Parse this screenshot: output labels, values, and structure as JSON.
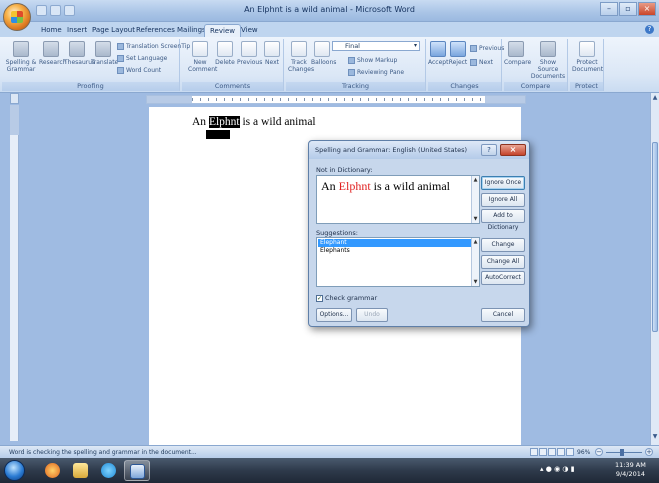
{
  "window": {
    "title": "An Elphnt is a wild animal - Microsoft Word"
  },
  "tabs": [
    "Home",
    "Insert",
    "Page Layout",
    "References",
    "Mailings",
    "Review",
    "View"
  ],
  "active_tab": "Review",
  "ribbon": {
    "proofing": {
      "label": "Proofing",
      "spelling": "Spelling & Grammar",
      "research": "Research",
      "thesaurus": "Thesaurus",
      "translate": "Translate",
      "translation_screentip": "Translation ScreenTip",
      "set_language": "Set Language",
      "word_count": "Word Count"
    },
    "comments": {
      "label": "Comments",
      "new": "New Comment",
      "delete": "Delete",
      "previous": "Previous",
      "next": "Next"
    },
    "tracking": {
      "label": "Tracking",
      "track_changes": "Track Changes",
      "balloons": "Balloons",
      "display_select": "Final",
      "show_markup": "Show Markup",
      "reviewing_pane": "Reviewing Pane"
    },
    "changes": {
      "label": "Changes",
      "accept": "Accept",
      "reject": "Reject",
      "previous": "Previous",
      "next": "Next"
    },
    "compare": {
      "label": "Compare",
      "compare": "Compare",
      "show_source": "Show Source Documents"
    },
    "protect": {
      "label": "Protect",
      "protect_document": "Protect Document"
    }
  },
  "document": {
    "before": "An ",
    "selected": "Elphnt",
    "after": " is a wild animal"
  },
  "dialog": {
    "title": "Spelling and Grammar: English (United States)",
    "not_in_dictionary_label": "Not in Dictionary:",
    "sentence_before": "An ",
    "error_word": "Elphnt",
    "sentence_after": " is a wild animal",
    "suggestions_label": "Suggestions:",
    "suggestions": [
      "Elephant",
      "Elephants"
    ],
    "selected_suggestion": "Elephant",
    "buttons": {
      "ignore_once": "Ignore Once",
      "ignore_all": "Ignore All",
      "add_to_dictionary": "Add to Dictionary",
      "change": "Change",
      "change_all": "Change All",
      "autocorrect": "AutoCorrect",
      "options": "Options...",
      "undo": "Undo",
      "cancel": "Cancel"
    },
    "check_grammar": "Check grammar",
    "check_grammar_checked": true
  },
  "status": {
    "text": "Word is checking the spelling and grammar in the document...",
    "zoom": "96%"
  },
  "taskbar": {
    "time": "11:39 AM",
    "date": "9/4/2014"
  }
}
